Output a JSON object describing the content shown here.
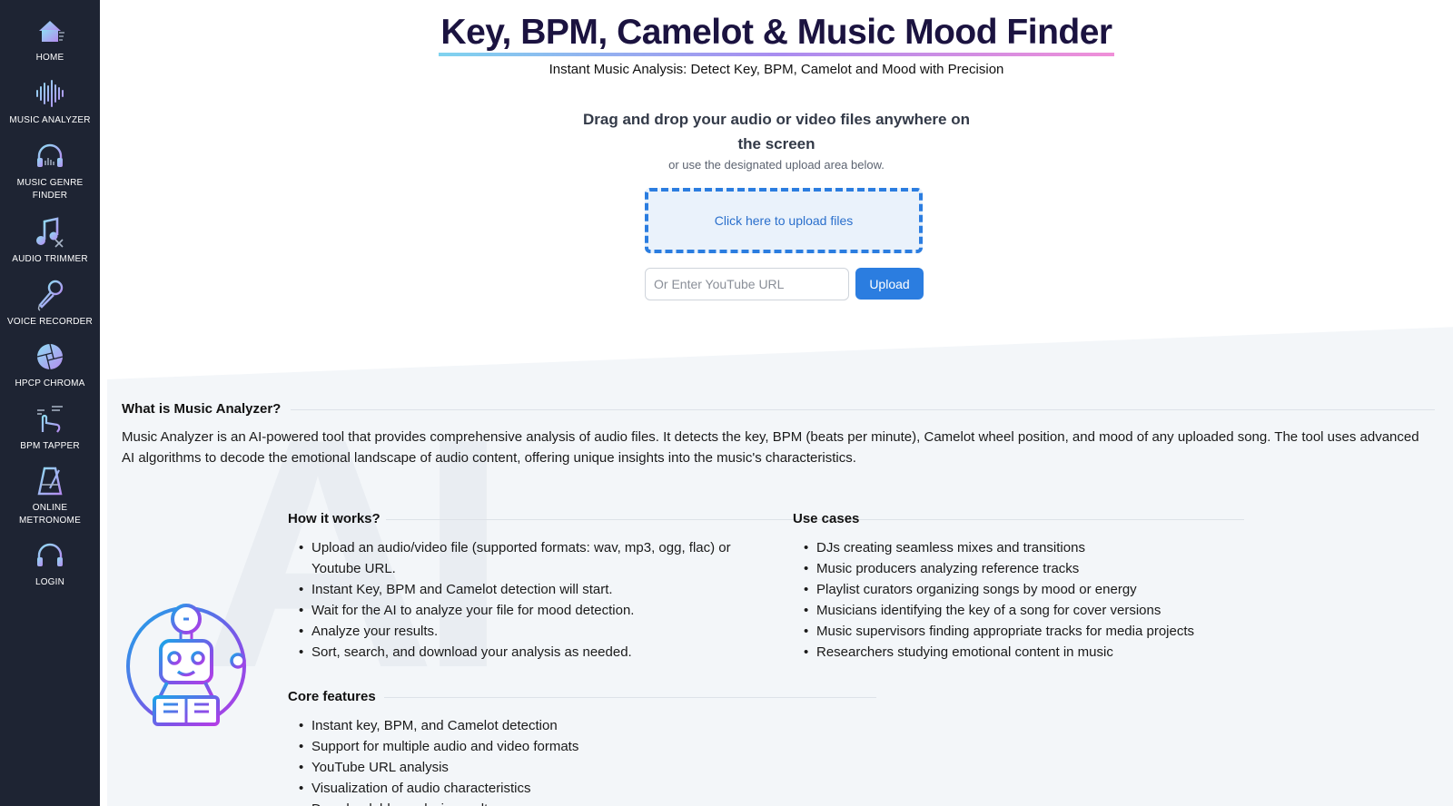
{
  "sidebar": {
    "items": [
      {
        "label": "HOME",
        "icon": "home-icon"
      },
      {
        "label": "MUSIC ANALYZER",
        "icon": "waveform-icon"
      },
      {
        "label": "MUSIC GENRE FINDER",
        "icon": "headphones-search-icon"
      },
      {
        "label": "AUDIO TRIMMER",
        "icon": "music-note-scissors-icon"
      },
      {
        "label": "VOICE RECORDER",
        "icon": "microphone-icon"
      },
      {
        "label": "HPCP CHROMA",
        "icon": "chroma-wheel-icon"
      },
      {
        "label": "BPM TAPPER",
        "icon": "tap-hand-icon"
      },
      {
        "label": "ONLINE METRONOME",
        "icon": "metronome-icon"
      },
      {
        "label": "LOGIN",
        "icon": "headphones-login-icon"
      }
    ]
  },
  "hero": {
    "title": "Key, BPM, Camelot & Music Mood Finder",
    "subtitle": "Instant Music Analysis: Detect Key, BPM, Camelot and Mood with Precision"
  },
  "upload": {
    "drop_title": "Drag and drop your audio or video files anywhere on the screen",
    "drop_sub": "or use the designated upload area below.",
    "box_label": "Click here to upload files",
    "url_placeholder": "Or Enter YouTube URL",
    "button_label": "Upload"
  },
  "about": {
    "watermark": "AI",
    "heading": "What is Music Analyzer?",
    "text": "Music Analyzer is an AI-powered tool that provides comprehensive analysis of audio files. It detects the key, BPM (beats per minute), Camelot wheel position, and mood of any uploaded song. The tool uses advanced AI algorithms to decode the emotional landscape of audio content, offering unique insights into the music's characteristics."
  },
  "how_it_works": {
    "heading": "How it works?",
    "items": [
      "Upload an audio/video file (supported formats: wav, mp3, ogg, flac) or Youtube URL.",
      "Instant Key, BPM and Camelot detection will start.",
      "Wait for the AI to analyze your file for mood detection.",
      "Analyze your results.",
      "Sort, search, and download your analysis as needed."
    ]
  },
  "use_cases": {
    "heading": "Use cases",
    "items": [
      "DJs creating seamless mixes and transitions",
      "Music producers analyzing reference tracks",
      "Playlist curators organizing songs by mood or energy",
      "Musicians identifying the key of a song for cover versions",
      "Music supervisors finding appropriate tracks for media projects",
      "Researchers studying emotional content in music"
    ]
  },
  "core_features": {
    "heading": "Core features",
    "items": [
      "Instant key, BPM, and Camelot detection",
      "Support for multiple audio and video formats",
      "YouTube URL analysis",
      "Visualization of audio characteristics",
      "Downloadable analysis results"
    ]
  },
  "colors": {
    "sidebar_bg": "#1e2433",
    "accent": "#2b7de0",
    "icon_gradient_start": "#7fd3ef",
    "icon_gradient_end": "#b48cf0"
  }
}
